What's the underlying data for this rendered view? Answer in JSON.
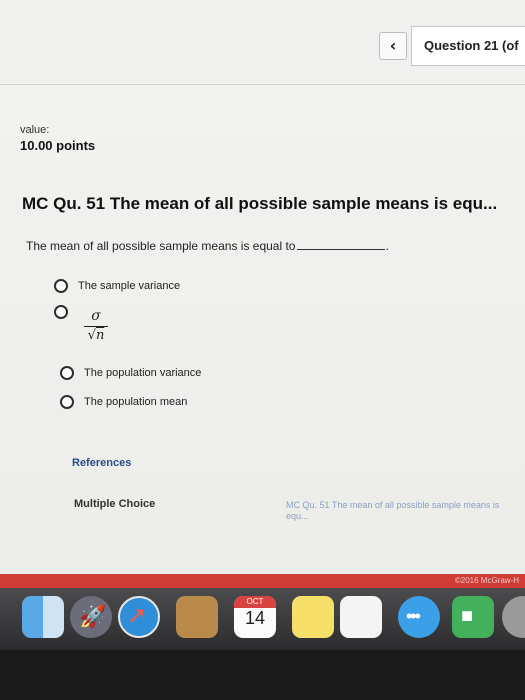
{
  "header": {
    "back_glyph": "‹",
    "question_label": "Question 21 (of"
  },
  "score": {
    "label": "value:",
    "points": "10.00 points"
  },
  "question": {
    "title": "MC Qu. 51 The mean of all possible sample means is equ...",
    "prompt": "The mean of all possible sample means is equal to",
    "prompt_end": ".",
    "options": [
      {
        "label": "The sample variance"
      },
      {
        "numerator": "σ",
        "denominator_root": "√",
        "denominator_var": "n"
      },
      {
        "label": "The population variance"
      },
      {
        "label": "The population mean"
      }
    ]
  },
  "footer": {
    "references": "References",
    "type_label": "Multiple Choice",
    "question_link": "MC Qu. 51 The mean of all possible sample means is equ...",
    "copyright": "©2016 McGraw-H"
  },
  "dock": {
    "calendar_month": "OCT",
    "calendar_day": "14",
    "messages_glyph": "•••",
    "launchpad_glyph": "🚀",
    "safari_glyph": "➚",
    "facetime_glyph": "■"
  }
}
